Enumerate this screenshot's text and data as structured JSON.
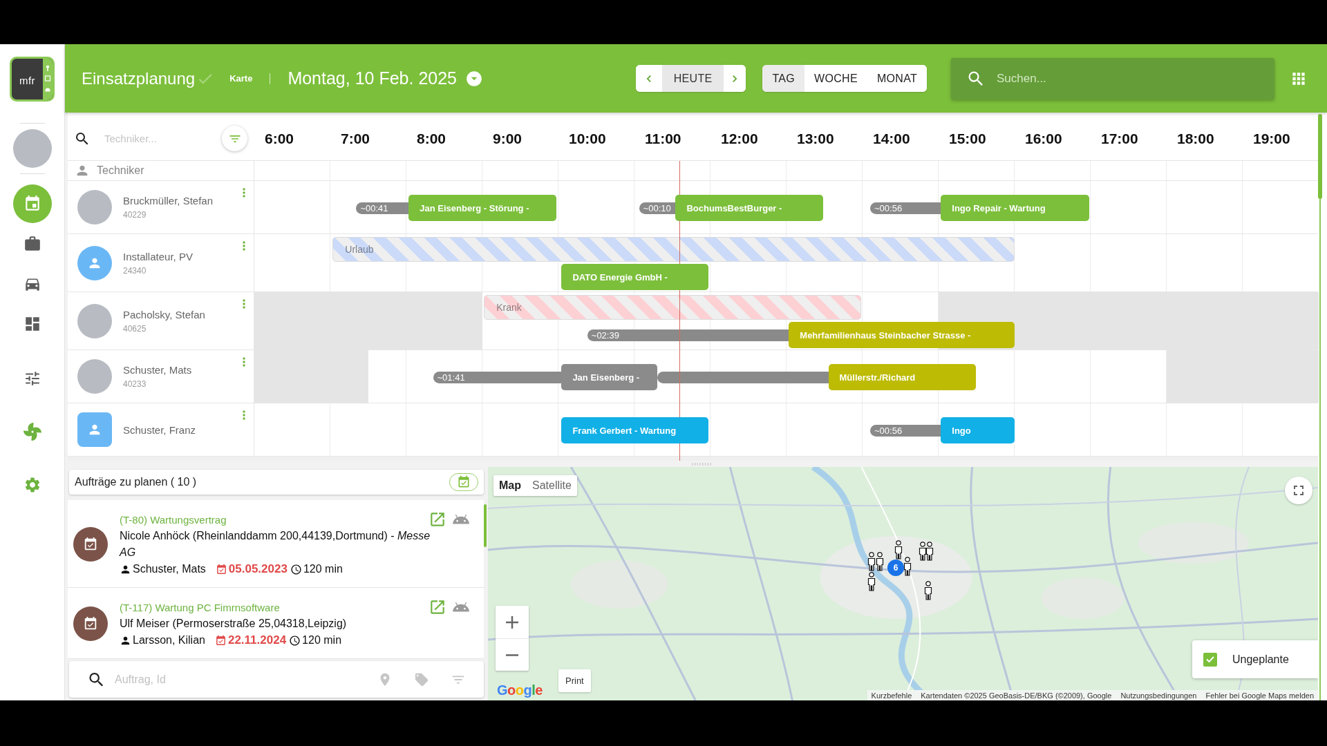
{
  "logo": {
    "text": "mfr"
  },
  "sidebar": {
    "main": [
      {
        "selected": true,
        "color": "#7cbf3b"
      },
      {
        "selected": false,
        "color": "#5c5c5c"
      },
      {
        "selected": false,
        "color": "#5c5c5c"
      },
      {
        "selected": false,
        "color": "#5c5c5c"
      }
    ],
    "tools": [
      {
        "selected": false,
        "color": "#5c5c5c"
      },
      {
        "selected": false,
        "color": "#6db33f"
      },
      {
        "selected": false,
        "color": "#6db33f"
      }
    ]
  },
  "header": {
    "title": "Einsatzplanung",
    "link": "Karte",
    "date": "Montag, 10 Feb. 2025",
    "today": "HEUTE",
    "view_modes": [
      {
        "label": "TAG",
        "selected": true
      },
      {
        "label": "WOCHE",
        "selected": false
      },
      {
        "label": "MONAT",
        "selected": false
      }
    ],
    "search": {
      "placeholder": "Suchen..."
    }
  },
  "scheduler": {
    "search": {
      "placeholder": "Techniker..."
    },
    "hours": [
      "6:00",
      "7:00",
      "8:00",
      "9:00",
      "10:00",
      "11:00",
      "12:00",
      "13:00",
      "14:00",
      "15:00",
      "16:00",
      "17:00",
      "18:00",
      "19:00"
    ],
    "resource_header": "Techniker",
    "technicians": [
      {
        "name": "Bruckmüller, Stefan",
        "id": "40229",
        "avatar": {
          "kind": "photo"
        },
        "lanes": [
          {
            "entries": [
              {
                "kind": "travel",
                "label": "~00:41"
              },
              {
                "kind": "job",
                "label": "Jan Eisenberg - Störung -",
                "color": "#7cbf3b"
              },
              {
                "kind": "travel",
                "label": "~00:10"
              },
              {
                "kind": "job",
                "label": "BochumsBestBurger -",
                "color": "#7cbf3b"
              },
              {
                "kind": "travel",
                "label": "~00:56"
              },
              {
                "kind": "job",
                "label": "Ingo Repair - Wartung",
                "color": "#7cbf3b"
              }
            ]
          }
        ]
      },
      {
        "name": "Installateur, PV",
        "id": "24340",
        "avatar": {
          "kind": "icon"
        },
        "lanes": [
          {
            "entries": [
              {
                "kind": "absence",
                "label": "Urlaub",
                "color": "#cbdaf9"
              }
            ]
          },
          {
            "entries": [
              {
                "kind": "job",
                "label": "DATO Energie GmbH -",
                "color": "#7cbf3b"
              }
            ]
          }
        ]
      },
      {
        "name": "Pacholsky, Stefan",
        "id": "40625",
        "avatar": {
          "kind": "photo"
        },
        "lanes": [
          {
            "entries": [
              {
                "kind": "absence",
                "label": "Krank",
                "color": "#fdd0d4"
              }
            ]
          },
          {
            "entries": [
              {
                "kind": "travel",
                "label": "~02:39"
              },
              {
                "kind": "job",
                "label": "Mehrfamilienhaus Steinbacher Strasse -",
                "color": "#bdbb04"
              }
            ]
          }
        ]
      },
      {
        "name": "Schuster, Mats",
        "id": "40233",
        "avatar": {
          "kind": "photo"
        },
        "lanes": [
          {
            "entries": [
              {
                "kind": "travel",
                "label": "~01:41"
              },
              {
                "kind": "job",
                "label": "Jan Eisenberg -",
                "color": "#8b8b8b"
              },
              {
                "kind": "travel"
              },
              {
                "kind": "job",
                "label": "Müllerstr./Richard",
                "color": "#bdbb04"
              }
            ]
          }
        ]
      },
      {
        "name": "Schuster, Franz",
        "avatar": {
          "kind": "icon-square"
        },
        "lanes": [
          {
            "entries": [
              {
                "kind": "job",
                "label": "Frank Gerbert - Wartung",
                "color": "#11b0e6"
              },
              {
                "kind": "travel",
                "label": "~00:56"
              },
              {
                "kind": "job",
                "label": "Ingo",
                "color": "#11b0e6"
              }
            ]
          }
        ]
      }
    ]
  },
  "orders": {
    "title": "Aufträge zu planen ( 10 )",
    "items": [
      {
        "title": "(T-80) Wartungsvertrag",
        "customer": "Nicole Anhöck (Rheinlanddamm 200,44139,Dortmund) - *Messe AG*",
        "technician": "Schuster, Mats",
        "date": "05.05.2023",
        "overdue": true,
        "duration": "120 min"
      },
      {
        "title": "(T-117) Wartung PC Fimrnsoftware",
        "customer": "Ulf Meiser (Permoserstraße 25,04318,Leipzig)",
        "technician": "Larsson, Kilian",
        "date": "22.11.2024",
        "overdue": true,
        "duration": "120 min"
      }
    ],
    "search": {
      "placeholder": "Auftrag, Id"
    }
  },
  "map": {
    "map_types": [
      {
        "label": "Map",
        "selected": true
      },
      {
        "label": "Satellite",
        "selected": false
      }
    ],
    "markers": [
      {
        "kind": "person"
      },
      {
        "kind": "person"
      },
      {
        "kind": "person"
      },
      {
        "kind": "person"
      },
      {
        "kind": "person"
      },
      {
        "kind": "person"
      },
      {
        "kind": "person"
      },
      {
        "kind": "person"
      },
      {
        "kind": "cluster",
        "label": "6"
      }
    ],
    "print": "Print",
    "legend": {
      "label": "Ungeplante",
      "checked": true
    },
    "logo": "Google",
    "attribution": {
      "shortcuts": "Kurzbefehle",
      "credit": "Kartendaten ©2025 GeoBasis-DE/BKG (©2009), Google",
      "links": [
        "Nutzungsbedingungen",
        "Fehler bei Google Maps melden"
      ]
    }
  }
}
